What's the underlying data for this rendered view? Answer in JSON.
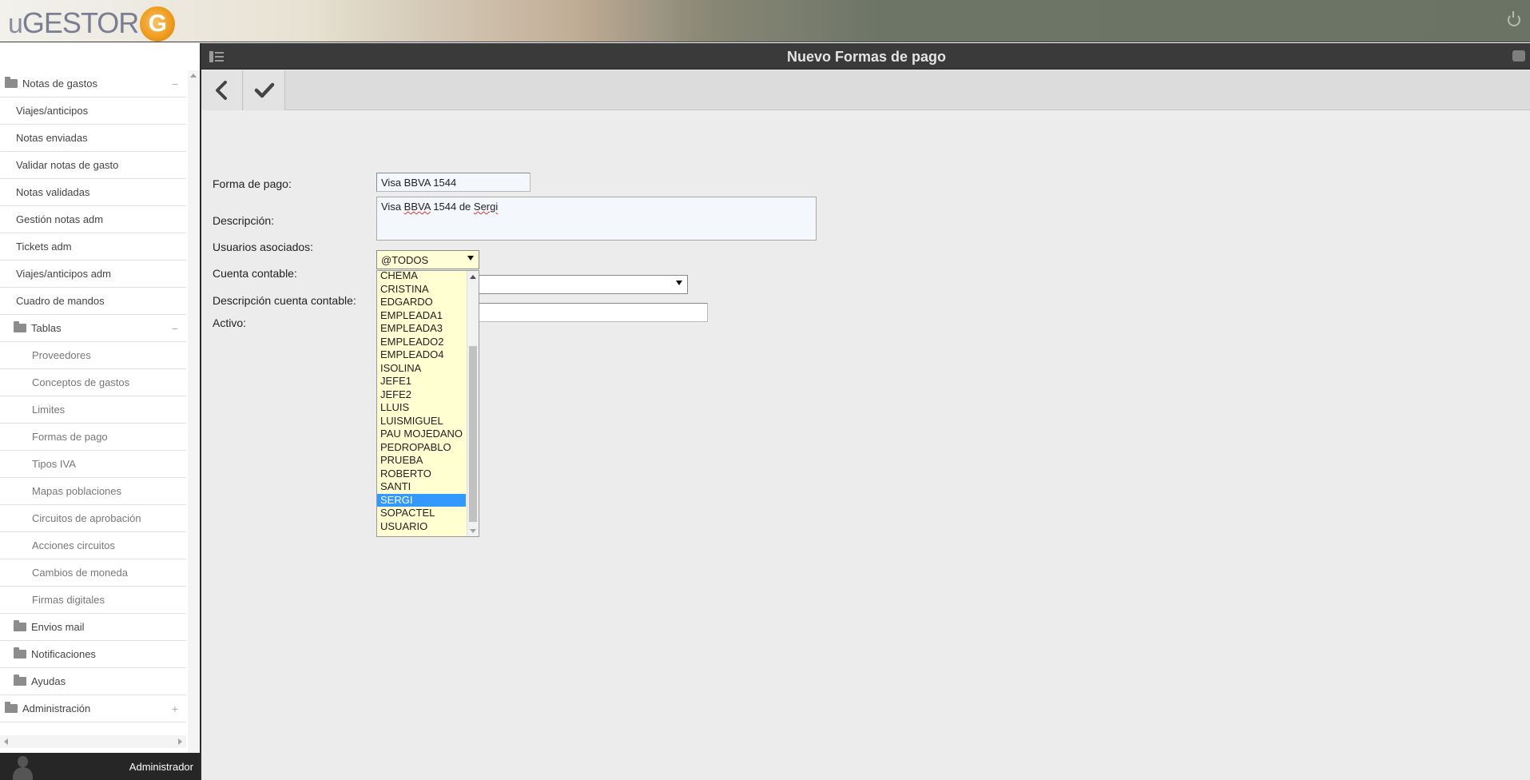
{
  "header": {
    "logo_u": "u",
    "logo_main": "GESTOR",
    "logo_g": "G"
  },
  "sidebar": {
    "items": [
      {
        "label": "Notas de gastos",
        "toggle": "−"
      },
      {
        "label": "Viajes/anticipos"
      },
      {
        "label": "Notas enviadas"
      },
      {
        "label": "Validar notas de gasto"
      },
      {
        "label": "Notas validadas"
      },
      {
        "label": "Gestión notas adm"
      },
      {
        "label": "Tickets adm"
      },
      {
        "label": "Viajes/anticipos adm"
      },
      {
        "label": "Cuadro de mandos"
      },
      {
        "label": "Tablas",
        "toggle": "−"
      },
      {
        "label": "Proveedores"
      },
      {
        "label": "Conceptos de gastos"
      },
      {
        "label": "Limites"
      },
      {
        "label": "Formas de pago"
      },
      {
        "label": "Tipos IVA"
      },
      {
        "label": "Mapas poblaciones"
      },
      {
        "label": "Circuitos de aprobación"
      },
      {
        "label": "Acciones circuitos"
      },
      {
        "label": "Cambios de moneda"
      },
      {
        "label": "Firmas digitales"
      },
      {
        "label": "Envios mail"
      },
      {
        "label": "Notificaciones"
      },
      {
        "label": "Ayudas"
      },
      {
        "label": "Administración",
        "toggle": "+"
      }
    ],
    "user": "Administrador"
  },
  "main": {
    "title": "Nuevo Formas de pago",
    "form": {
      "forma_pago_label": "Forma de pago:",
      "forma_pago_value": "Visa BBVA 1544",
      "descripcion_label": "Descripción:",
      "descripcion_prefix": "Visa ",
      "descripcion_w1": "BBVA",
      "descripcion_mid": " 1544 de ",
      "descripcion_w2": "Sergi",
      "usuarios_label": "Usuarios asociados:",
      "usuarios_value": "@TODOS",
      "cuenta_label": "Cuenta contable:",
      "desc_cuenta_label": "Descripción cuenta contable:",
      "activo_label": "Activo:"
    },
    "dropdown_options": [
      "CHEMA",
      "CRISTINA",
      "EDGARDO",
      "EMPLEADA1",
      "EMPLEADA3",
      "EMPLEADO2",
      "EMPLEADO4",
      "ISOLINA",
      "JEFE1",
      "JEFE2",
      "LLUIS",
      "LUISMIGUEL",
      "PAU MOJEDANO",
      "PEDROPABLO",
      "PRUEBA",
      "ROBERTO",
      "SANTI",
      "SERGI",
      "SOPACTEL",
      "USUARIO"
    ],
    "dropdown_selected": "SERGI"
  },
  "colors": {
    "selected_option": "#3399ff",
    "dropdown_bg": "#ffffd2",
    "title_bar": "#3a3a3a"
  }
}
